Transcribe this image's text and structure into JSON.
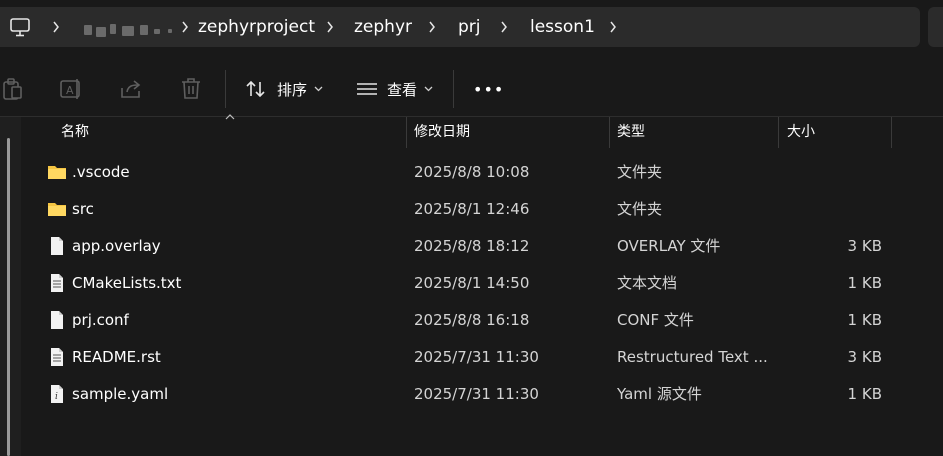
{
  "address_bar": {
    "icon": "monitor-icon",
    "crumbs": [
      "zephyrproject",
      "zephyr",
      "prj",
      "lesson1"
    ]
  },
  "toolbar": {
    "sort_label": "排序",
    "view_label": "查看",
    "more_label": "•••"
  },
  "columns": {
    "name": "名称",
    "date": "修改日期",
    "type": "类型",
    "size": "大小"
  },
  "files": [
    {
      "name": ".vscode",
      "date": "2025/8/8 10:08",
      "type": "文件夹",
      "size": "",
      "icon": "folder-icon"
    },
    {
      "name": "src",
      "date": "2025/8/1 12:46",
      "type": "文件夹",
      "size": "",
      "icon": "folder-icon"
    },
    {
      "name": "app.overlay",
      "date": "2025/8/8 18:12",
      "type": "OVERLAY 文件",
      "size": "3 KB",
      "icon": "file-icon"
    },
    {
      "name": "CMakeLists.txt",
      "date": "2025/8/1 14:50",
      "type": "文本文档",
      "size": "1 KB",
      "icon": "text-file-icon"
    },
    {
      "name": "prj.conf",
      "date": "2025/8/8 16:18",
      "type": "CONF 文件",
      "size": "1 KB",
      "icon": "file-icon"
    },
    {
      "name": "README.rst",
      "date": "2025/7/31 11:30",
      "type": "Restructured Text ...",
      "size": "3 KB",
      "icon": "text-file-icon"
    },
    {
      "name": "sample.yaml",
      "date": "2025/7/31 11:30",
      "type": "Yaml 源文件",
      "size": "1 KB",
      "icon": "yaml-file-icon"
    }
  ],
  "colors": {
    "background": "#191919",
    "address_bar": "#2b2b2b",
    "folder": "#f5c542",
    "text": "#ffffff",
    "secondary_text": "#d4d4d4"
  }
}
